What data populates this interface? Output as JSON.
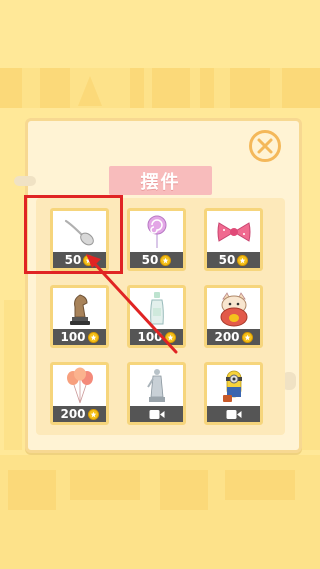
{
  "dialog": {
    "title": "摆件",
    "close_icon": "close-x-icon"
  },
  "items": [
    {
      "name": "spoon",
      "icon": "spoon-icon",
      "price": "50",
      "cost_type": "coin"
    },
    {
      "name": "lollipop",
      "icon": "lollipop-icon",
      "price": "50",
      "cost_type": "coin"
    },
    {
      "name": "bow",
      "icon": "bow-icon",
      "price": "50",
      "cost_type": "coin"
    },
    {
      "name": "chess-knight",
      "icon": "chess-knight-icon",
      "price": "100",
      "cost_type": "coin"
    },
    {
      "name": "bottle",
      "icon": "bottle-icon",
      "price": "100",
      "cost_type": "coin"
    },
    {
      "name": "lucky-cat",
      "icon": "lucky-cat-icon",
      "price": "200",
      "cost_type": "coin"
    },
    {
      "name": "balloons",
      "icon": "balloons-icon",
      "price": "200",
      "cost_type": "coin"
    },
    {
      "name": "statue",
      "icon": "statue-icon",
      "price": "",
      "cost_type": "video"
    },
    {
      "name": "minion",
      "icon": "minion-icon",
      "price": "",
      "cost_type": "video"
    }
  ],
  "colors": {
    "background": "#ffe898",
    "panel": "#fff3d4",
    "title_banner": "#f8bcbc",
    "price_bar": "#555555",
    "coin": "#f5c21c",
    "highlight": "#e02424"
  }
}
